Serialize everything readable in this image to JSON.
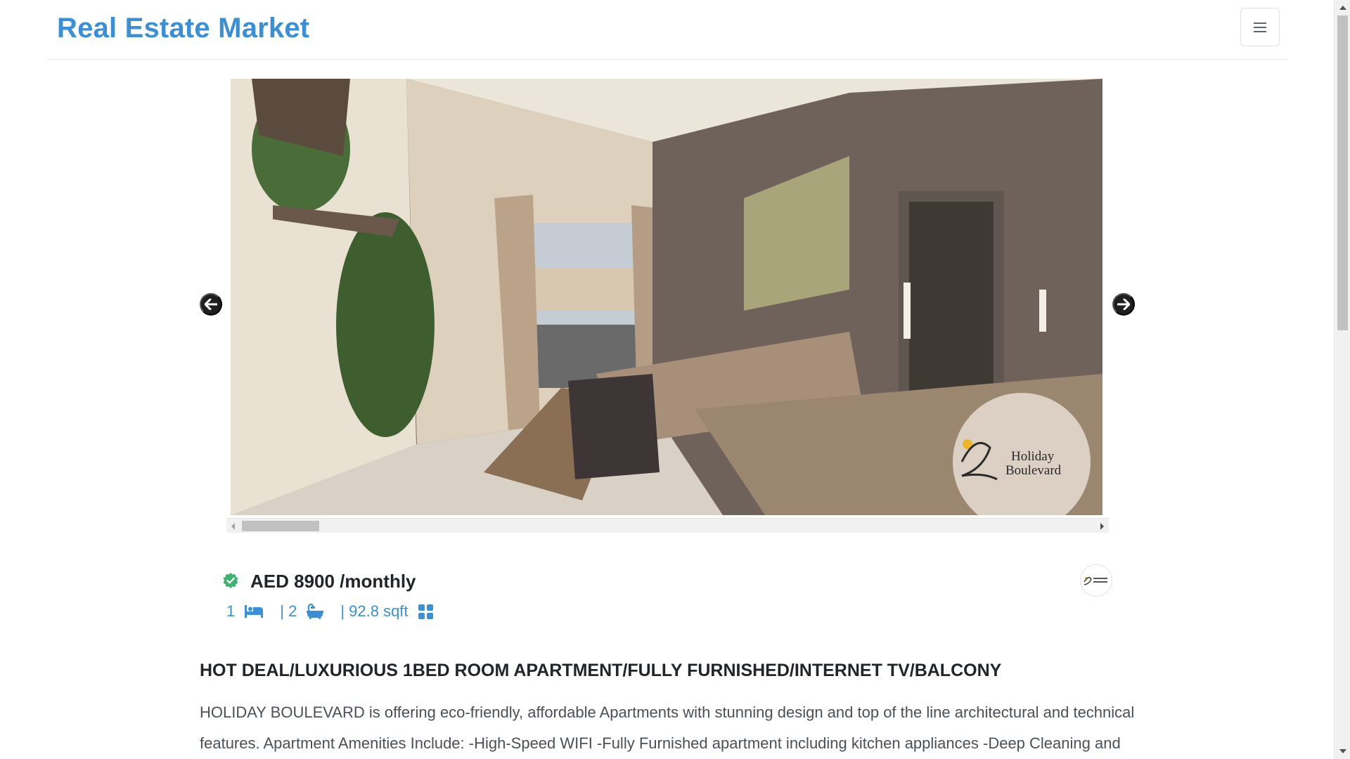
{
  "navbar": {
    "brand": "Real Estate Market",
    "menu_icon": "hamburger-menu-icon"
  },
  "carousel": {
    "photo_alt": "Furnished living room with dining table",
    "watermark_line1": "Holiday",
    "watermark_line2": "Boulevard",
    "prev_icon": "arrow-left-circle-icon",
    "next_icon": "arrow-right-circle-icon"
  },
  "listing": {
    "verified_icon": "verified-check-icon",
    "price": "AED 8900 /monthly",
    "bedrooms": "1",
    "bed_icon": "bed-icon",
    "bathrooms": "| 2",
    "bath_icon": "bathtub-icon",
    "area": "| 92.8 sqft",
    "area_icon": "grid-icon",
    "title": "HOT DEAL/LUXURIOUS 1BED ROOM APARTMENT/FULLY FURNISHED/INTERNET TV/BALCONY",
    "description": "HOLIDAY BOULEVARD is offering eco-friendly, affordable Apartments with stunning design and top of the line architectural and technical features. Apartment Amenities Include: -High-Speed WIFI -Fully Furnished apartment including kitchen appliances -Deep Cleaning and"
  },
  "colors": {
    "accent": "#3a8fd6",
    "verified": "#3cb371",
    "text": "#212529"
  }
}
